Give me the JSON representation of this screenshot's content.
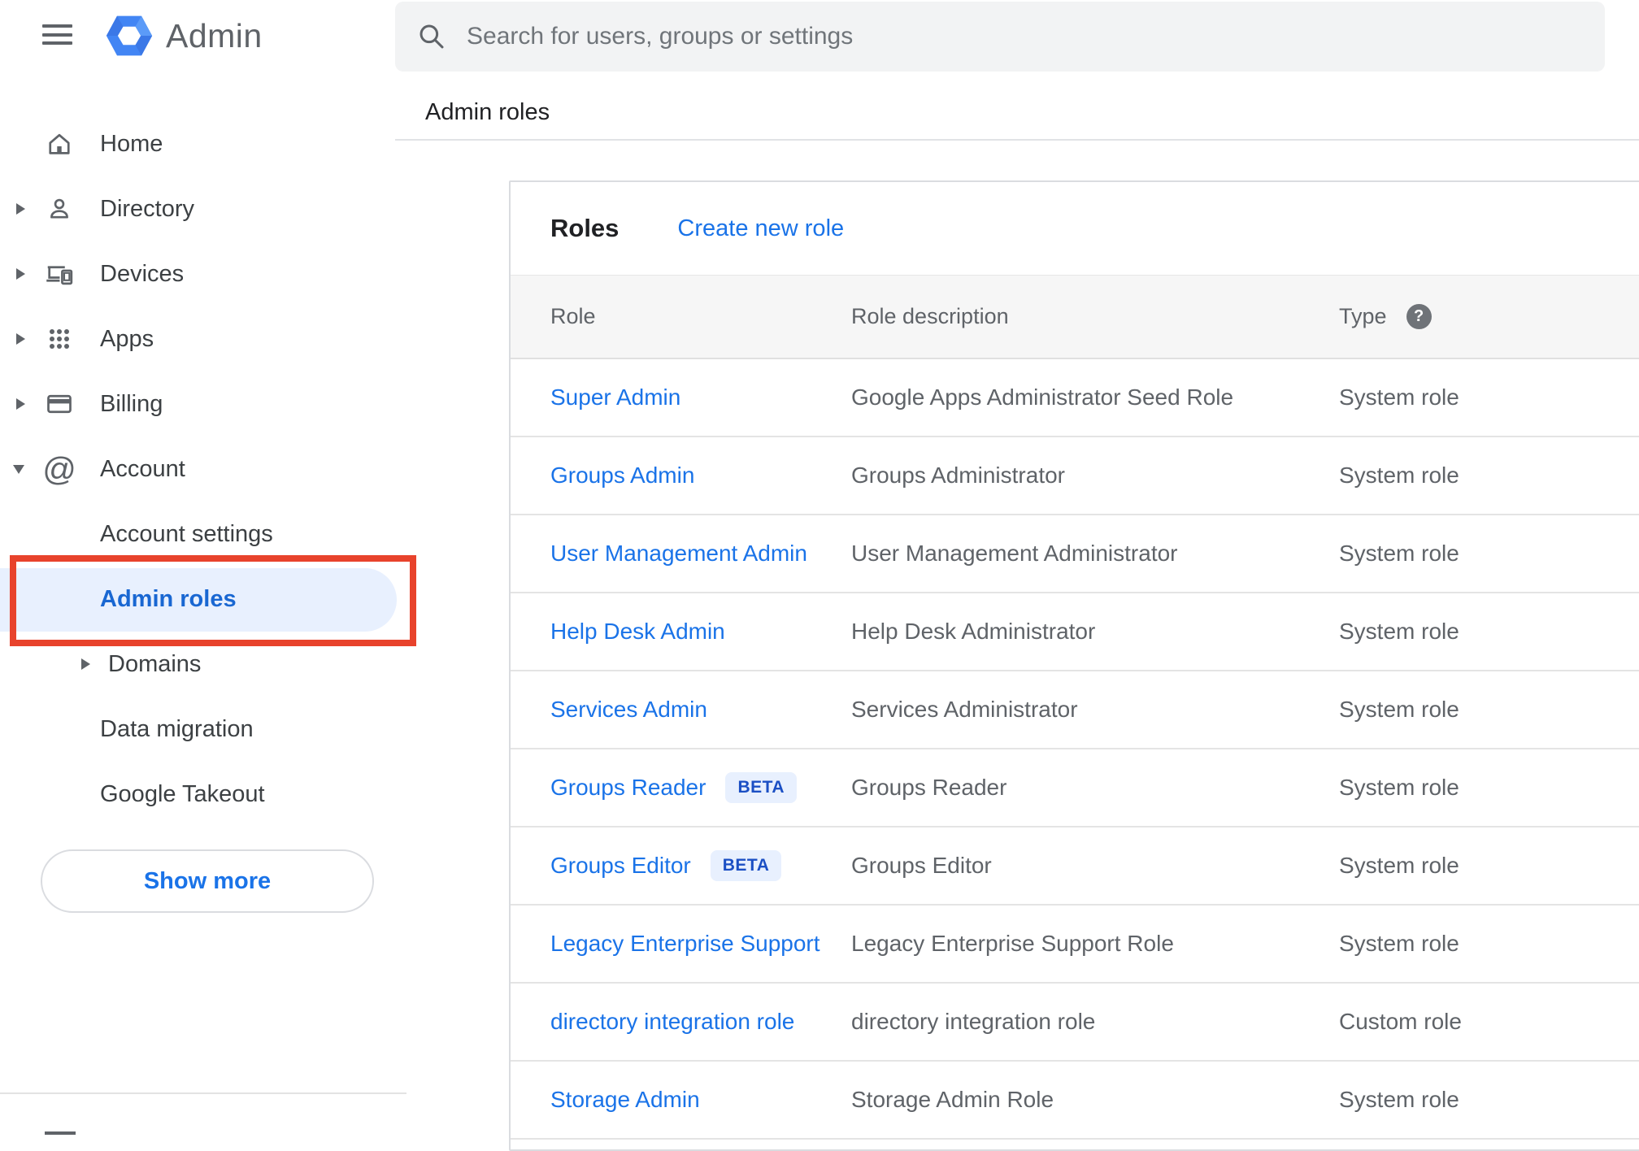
{
  "app": {
    "title": "Admin"
  },
  "search": {
    "placeholder": "Search for users, groups or settings"
  },
  "breadcrumb": "Admin roles",
  "sidebar": {
    "items": [
      {
        "label": "Home"
      },
      {
        "label": "Directory"
      },
      {
        "label": "Devices"
      },
      {
        "label": "Apps"
      },
      {
        "label": "Billing"
      },
      {
        "label": "Account"
      }
    ],
    "sub_items": [
      {
        "label": "Account settings"
      },
      {
        "label": "Admin roles",
        "selected": true
      },
      {
        "label": "Domains"
      },
      {
        "label": "Data migration"
      },
      {
        "label": "Google Takeout"
      }
    ],
    "show_more_label": "Show more"
  },
  "main": {
    "panel_title": "Roles",
    "create_link": "Create new role",
    "table": {
      "columns": [
        "Role",
        "Role description",
        "Type"
      ],
      "beta_label": "BETA",
      "rows": [
        {
          "role": "Super Admin",
          "beta": false,
          "description": "Google Apps Administrator Seed Role",
          "type": "System role"
        },
        {
          "role": "Groups Admin",
          "beta": false,
          "description": "Groups Administrator",
          "type": "System role"
        },
        {
          "role": "User Management Admin",
          "beta": false,
          "description": "User Management Administrator",
          "type": "System role"
        },
        {
          "role": "Help Desk Admin",
          "beta": false,
          "description": "Help Desk Administrator",
          "type": "System role"
        },
        {
          "role": "Services Admin",
          "beta": false,
          "description": "Services Administrator",
          "type": "System role"
        },
        {
          "role": "Groups Reader",
          "beta": true,
          "description": "Groups Reader",
          "type": "System role"
        },
        {
          "role": "Groups Editor",
          "beta": true,
          "description": "Groups Editor",
          "type": "System role"
        },
        {
          "role": "Legacy Enterprise Support",
          "beta": false,
          "description": "Legacy Enterprise Support Role",
          "type": "System role"
        },
        {
          "role": "directory integration role",
          "beta": false,
          "description": "directory integration role",
          "type": "Custom role"
        },
        {
          "role": "Storage Admin",
          "beta": false,
          "description": "Storage Admin Role",
          "type": "System role"
        }
      ]
    }
  },
  "colors": {
    "link_blue": "#1a73e8",
    "selected_text": "#1967d2",
    "selected_bg": "#e8f0fe",
    "annotation_red": "#e8432c",
    "logo_blue": "#4285f4"
  }
}
